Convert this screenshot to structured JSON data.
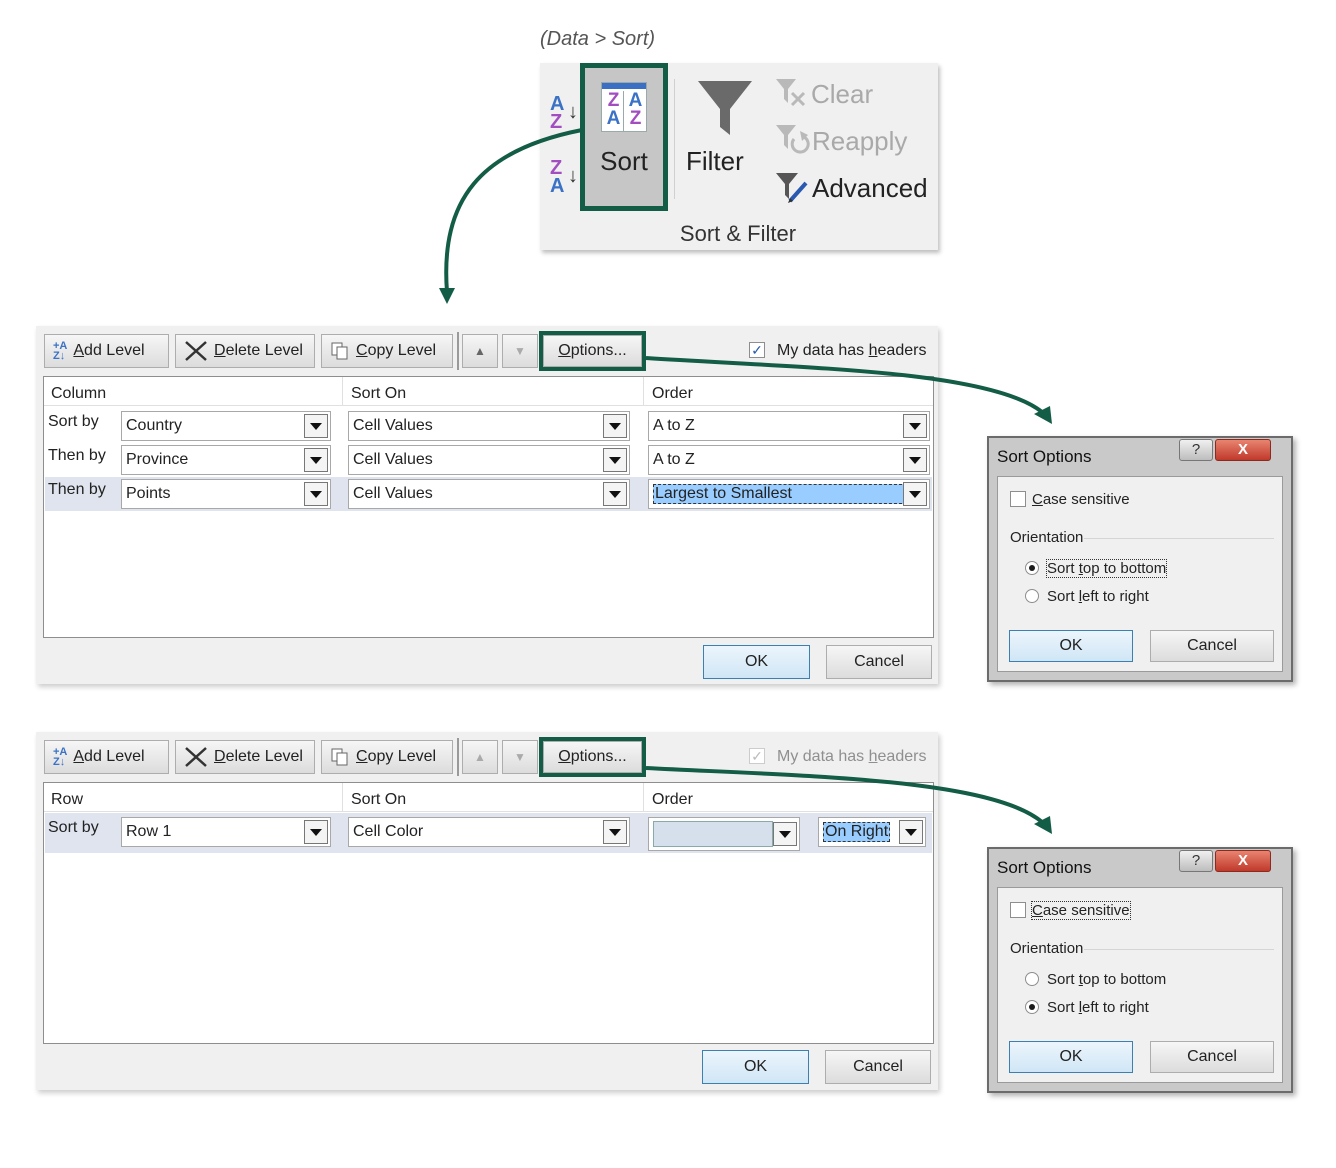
{
  "caption": "(Data > Sort)",
  "ribbon": {
    "sort_label": "Sort",
    "filter_label": "Filter",
    "clear_label": "Clear",
    "reapply_label": "Reapply",
    "advanced_label": "Advanced",
    "group_label": "Sort & Filter",
    "az_top": [
      "A",
      "Z"
    ],
    "az_bottom": [
      "Z",
      "A"
    ],
    "sort_icon": [
      "Z",
      "A",
      "A",
      "Z"
    ]
  },
  "dialog1": {
    "toolbar": {
      "add_level_pre": "",
      "add_level_u": "A",
      "add_level_rest": "dd Level",
      "delete_level_u": "D",
      "delete_level_rest": "elete Level",
      "copy_level_u": "C",
      "copy_level_rest": "opy Level",
      "options_u": "O",
      "options_rest": "ptions...",
      "headers_pre": "My data has ",
      "headers_u": "h",
      "headers_rest": "eaders",
      "headers_checked": true
    },
    "columns": {
      "col1": "Column",
      "col2": "Sort On",
      "col3": "Order"
    },
    "rows": [
      {
        "label": "Sort by",
        "column": "Country",
        "sort_on": "Cell Values",
        "order": "A to Z"
      },
      {
        "label": "Then by",
        "column": "Province",
        "sort_on": "Cell Values",
        "order": "A to Z"
      },
      {
        "label": "Then by",
        "column": "Points",
        "sort_on": "Cell Values",
        "order": "Largest to Smallest"
      }
    ],
    "ok_label": "OK",
    "cancel_label": "Cancel"
  },
  "dialog2": {
    "toolbar": {
      "add_level_u": "A",
      "add_level_rest": "dd Level",
      "delete_level_u": "D",
      "delete_level_rest": "elete Level",
      "copy_level_u": "C",
      "copy_level_rest": "opy Level",
      "options_u": "O",
      "options_rest": "ptions...",
      "headers_pre": "My data has ",
      "headers_u": "h",
      "headers_rest": "eaders",
      "headers_checked": true,
      "headers_disabled": true
    },
    "columns": {
      "col1": "Row",
      "col2": "Sort On",
      "col3": "Order"
    },
    "rows": [
      {
        "label": "Sort by",
        "row": "Row 1",
        "sort_on": "Cell Color",
        "color_value": "",
        "position": "On Right"
      }
    ],
    "ok_label": "OK",
    "cancel_label": "Cancel"
  },
  "options1": {
    "title": "Sort Options",
    "help": "?",
    "close": "X",
    "case_u": "C",
    "case_rest": "ase sensitive",
    "orientation_label": "Orientation",
    "top_pre": "Sort ",
    "top_u": "t",
    "top_rest": "op to bottom",
    "left_pre": "Sort ",
    "left_u": "l",
    "left_rest": "eft to right",
    "selected": "top_to_bottom",
    "ok_label": "OK",
    "cancel_label": "Cancel"
  },
  "options2": {
    "title": "Sort Options",
    "help": "?",
    "close": "X",
    "case_u": "C",
    "case_rest": "ase sensitive",
    "orientation_label": "Orientation",
    "top_pre": "Sort ",
    "top_u": "t",
    "top_rest": "op to bottom",
    "left_pre": "Sort ",
    "left_u": "l",
    "left_rest": "eft to right",
    "selected": "left_to_right",
    "ok_label": "OK",
    "cancel_label": "Cancel"
  },
  "colors": {
    "highlight": "#135c45",
    "selection": "#99ccff",
    "color_swatch": "#d6e0ec"
  }
}
